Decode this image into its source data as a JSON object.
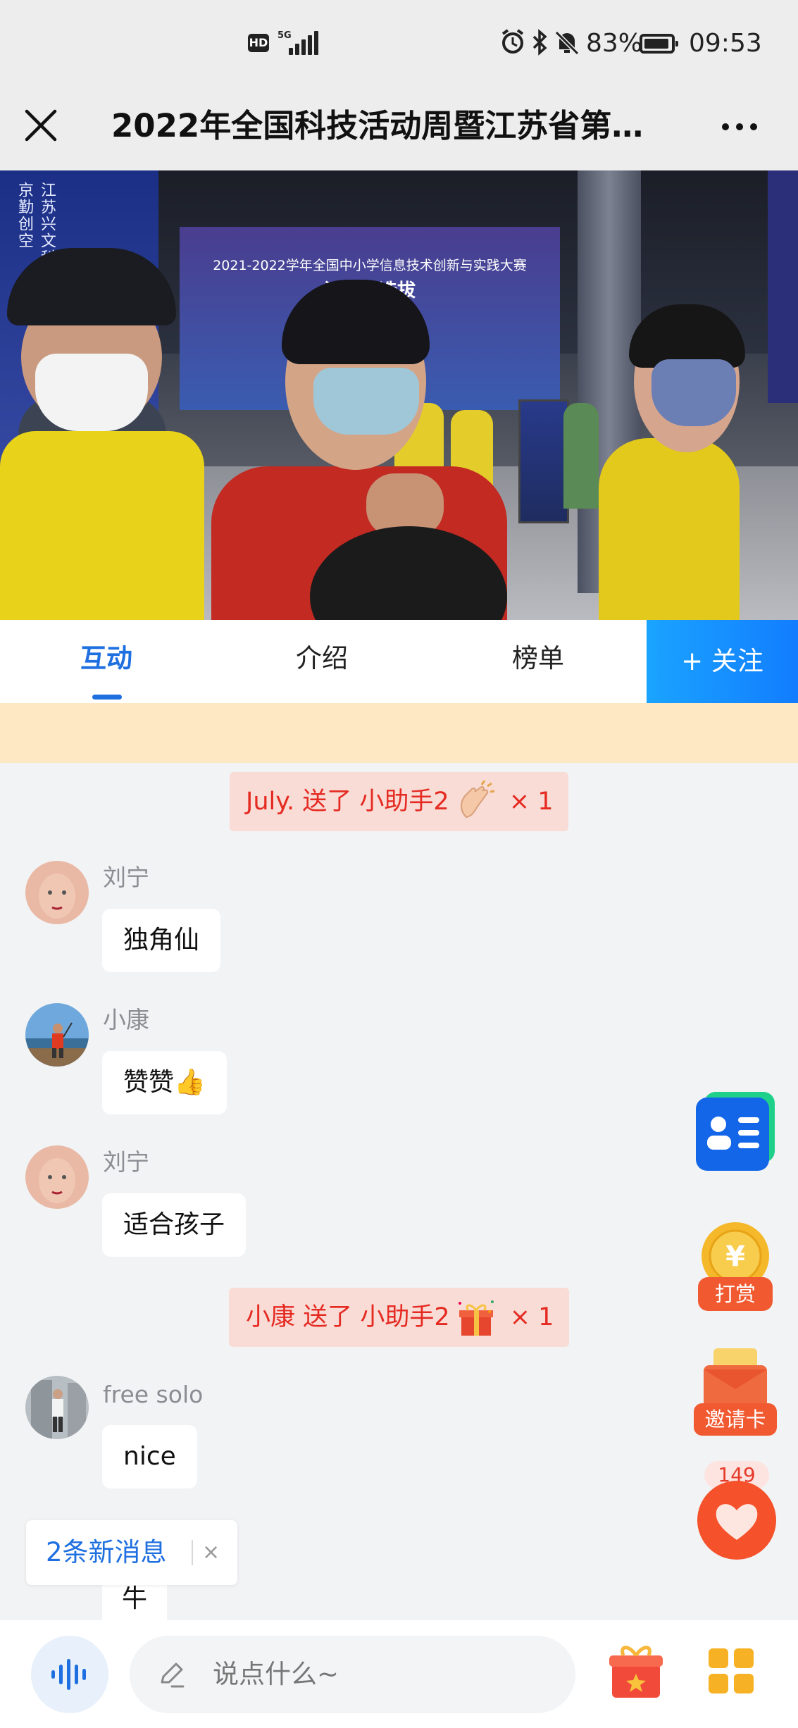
{
  "status_bar": {
    "hd": "HD",
    "network": "5G",
    "battery": "83%",
    "time": "09:53"
  },
  "header": {
    "title": "2022年全国科技活动周暨江苏省第…"
  },
  "video": {
    "banner_text": "江苏兴文科 江苏潜创 江苏咸亨 南京以馨文 南京勤创空",
    "backboard_line1": "2021-2022学年全国中小学信息技术创新与实践大赛",
    "backboard_line2": "江苏省选拔"
  },
  "tabs": [
    {
      "label": "互动",
      "active": true
    },
    {
      "label": "介绍",
      "active": false
    },
    {
      "label": "榜单",
      "active": false
    }
  ],
  "follow_label": "+ 关注",
  "feed": {
    "gift1": {
      "user": "July.",
      "action": "送了",
      "item": "小助手2",
      "count": "× 1",
      "emoji": "clapping-hands-icon"
    },
    "messages": [
      {
        "name": "刘宁",
        "text": "独角仙"
      },
      {
        "name": "小康",
        "text": "赞赞👍"
      },
      {
        "name": "刘宁",
        "text": "适合孩子"
      }
    ],
    "gift2": {
      "user": "小康",
      "action": "送了",
      "item": "小助手2",
      "count": "× 1",
      "emoji": "gift-box-icon"
    },
    "messages2": [
      {
        "name": "free solo",
        "text": "nice"
      },
      {
        "name": "",
        "text": "牛"
      }
    ]
  },
  "floating": {
    "tip_label": "打赏",
    "tip_coin": "¥",
    "invite_label": "邀请卡",
    "like_count": "149"
  },
  "new_messages": {
    "label": "2条新消息",
    "close": "×"
  },
  "input": {
    "placeholder": "说点什么~"
  },
  "colors": {
    "accent": "#1e6fe0",
    "gift_text": "#e52a22",
    "follow_bg": "#127dff"
  }
}
